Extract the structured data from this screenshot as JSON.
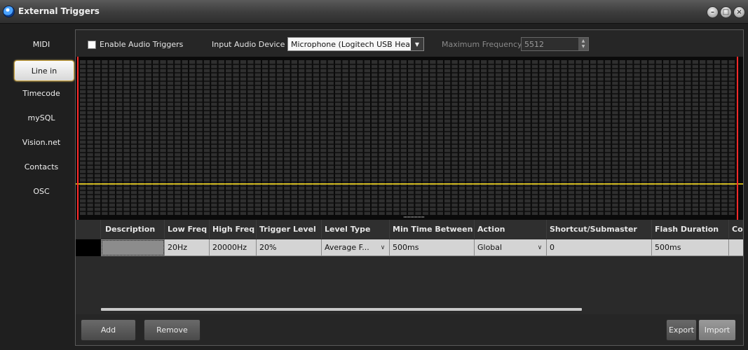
{
  "window": {
    "title": "External Triggers",
    "min_glyph": "–",
    "max_glyph": "□",
    "close_glyph": "×"
  },
  "sidebar": {
    "items": [
      {
        "label": "MIDI",
        "active": false
      },
      {
        "label": "Line in",
        "active": true
      },
      {
        "label": "Timecode",
        "active": false
      },
      {
        "label": "mySQL",
        "active": false
      },
      {
        "label": "Vision.net",
        "active": false
      },
      {
        "label": "Contacts",
        "active": false
      },
      {
        "label": "OSC",
        "active": false
      }
    ]
  },
  "toolbar": {
    "enable_audio_label": "Enable Audio Triggers",
    "enable_audio_checked": false,
    "input_device_label": "Input Audio Device",
    "input_device_value": "Microphone (Logitech USB Head",
    "max_freq_label": "Maximum Frequency",
    "max_freq_value": "5512"
  },
  "spectrum": {
    "trigger_line_color": "#ffe11a",
    "edge_marker_color": "#ff2a2a",
    "trigger_level_fraction": 0.2
  },
  "table": {
    "columns": [
      "Description",
      "Low Freq",
      "High Freq",
      "Trigger Level",
      "Level Type",
      "Min Time Between",
      "Action",
      "Shortcut/Submaster",
      "Flash Duration",
      "Co"
    ],
    "rows": [
      {
        "description": "",
        "low_freq": "20Hz",
        "high_freq": "20000Hz",
        "trigger_level": "20%",
        "level_type": "Average F...",
        "min_time_between": "500ms",
        "action": "Global",
        "shortcut": "0",
        "flash_duration": "500ms",
        "co": ""
      }
    ]
  },
  "buttons": {
    "add": "Add",
    "remove": "Remove",
    "export": "Export",
    "import": "Import"
  },
  "icons": {
    "app": "app-globe-icon",
    "dropdown": "▼",
    "spin_up": "▲",
    "spin_down": "▼",
    "cell_dropdown": "∨"
  }
}
